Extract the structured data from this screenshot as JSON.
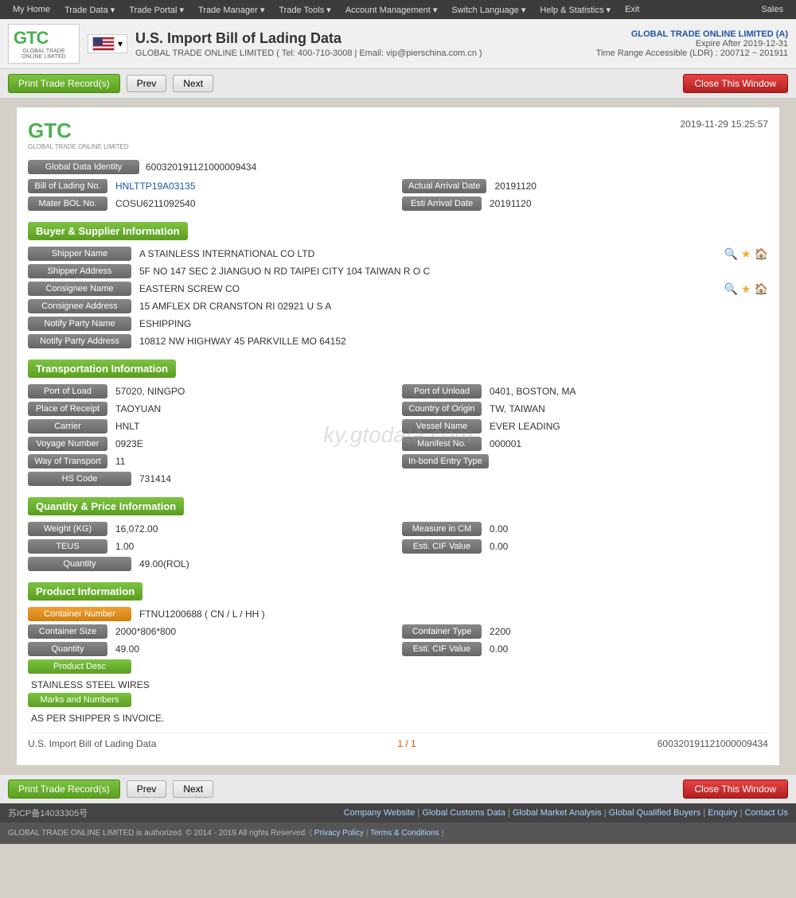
{
  "topnav": {
    "items": [
      "My Home",
      "Trade Data",
      "Trade Portal",
      "Trade Manager",
      "Trade Tools",
      "Account Management",
      "Switch Language",
      "Help & Statistics",
      "Exit"
    ],
    "right": "Sales"
  },
  "header": {
    "title": "U.S. Import Bill of Lading Data",
    "company_line": "GLOBAL TRADE ONLINE LIMITED ( Tel: 400-710-3008 | Email: vip@pierschina.com.cn )",
    "right_company": "GLOBAL TRADE ONLINE LIMITED (A)",
    "expire": "Expire After 2019-12-31",
    "ldr": "Time Range Accessible (LDR) : 200712 ~ 201911"
  },
  "toolbar": {
    "print_label": "Print Trade Record(s)",
    "prev_label": "Prev",
    "next_label": "Next",
    "close_label": "Close This Window"
  },
  "record": {
    "datetime": "2019-11-29 15:25:57",
    "global_data_identity_label": "Global Data Identity",
    "global_data_identity_value": "600320191121000009434",
    "bol_no_label": "Bill of Lading No.",
    "bol_no_value": "HNLTTP19A03135",
    "actual_arrival_label": "Actual Arrival Date",
    "actual_arrival_value": "20191120",
    "master_bol_label": "Mater BOL No.",
    "master_bol_value": "COSU6211092540",
    "esti_arrival_label": "Esti Arrival Date",
    "esti_arrival_value": "20191120",
    "sections": {
      "buyer_supplier": "Buyer & Supplier Information",
      "transportation": "Transportation Information",
      "quantity_price": "Quantity & Price Information",
      "product": "Product Information"
    },
    "shipper_name_label": "Shipper Name",
    "shipper_name_value": "A STAINLESS INTERNATIONAL CO LTD",
    "shipper_address_label": "Shipper Address",
    "shipper_address_value": "5F NO 147 SEC 2 JIANGUO N RD TAIPEI CITY 104 TAIWAN R O C",
    "consignee_name_label": "Consignee Name",
    "consignee_name_value": "EASTERN SCREW CO",
    "consignee_address_label": "Consignee Address",
    "consignee_address_value": "15 AMFLEX DR CRANSTON RI 02921 U S A",
    "notify_party_name_label": "Notify Party Name",
    "notify_party_name_value": "ESHIPPING",
    "notify_party_address_label": "Notify Party Address",
    "notify_party_address_value": "10812 NW HIGHWAY 45 PARKVILLE MO 64152",
    "port_of_load_label": "Port of Load",
    "port_of_load_value": "57020, NINGPO",
    "port_of_unload_label": "Port of Unload",
    "port_of_unload_value": "0401, BOSTON, MA",
    "place_of_receipt_label": "Place of Receipt",
    "place_of_receipt_value": "TAOYUAN",
    "country_of_origin_label": "Country of Origin",
    "country_of_origin_value": "TW, TAIWAN",
    "carrier_label": "Carrier",
    "carrier_value": "HNLT",
    "vessel_name_label": "Vessel Name",
    "vessel_name_value": "EVER LEADING",
    "voyage_number_label": "Voyage Number",
    "voyage_number_value": "0923E",
    "manifest_no_label": "Manifest No.",
    "manifest_no_value": "000001",
    "way_of_transport_label": "Way of Transport",
    "way_of_transport_value": "11",
    "inbond_entry_label": "In-bond Entry Type",
    "inbond_entry_value": "",
    "hs_code_label": "HS Code",
    "hs_code_value": "731414",
    "weight_kg_label": "Weight (KG)",
    "weight_kg_value": "16,072.00",
    "measure_cm_label": "Measure in CM",
    "measure_cm_value": "0.00",
    "teus_label": "TEUS",
    "teus_value": "1.00",
    "esti_cif_label": "Esti. CIF Value",
    "esti_cif_value": "0.00",
    "quantity_label": "Quantity",
    "quantity_value": "49.00(ROL)",
    "container_number_label": "Container Number",
    "container_number_value": "FTNU1200688 ( CN / L / HH )",
    "container_size_label": "Container Size",
    "container_size_value": "2000*806*800",
    "container_type_label": "Container Type",
    "container_type_value": "2200",
    "quantity2_label": "Quantity",
    "quantity2_value": "49.00",
    "esti_cif2_label": "Esti. CIF Value",
    "esti_cif2_value": "0.00",
    "product_desc_label": "Product Desc",
    "product_desc_value": "STAINLESS STEEL WIRES",
    "marks_numbers_label": "Marks and Numbers",
    "marks_numbers_value": "AS PER SHIPPER S INVOICE.",
    "bottom_label": "U.S. Import Bill of Lading Data",
    "pagination": "1 / 1",
    "bottom_id": "600320191121000009434"
  },
  "footer": {
    "icp": "苏ICP备14033305号",
    "links": [
      "Company Website",
      "Global Customs Data",
      "Global Market Analysis",
      "Global Qualified Buyers",
      "Enquiry",
      "Contact Us"
    ],
    "copyright": "GLOBAL TRADE ONLINE LIMITED is authorized. © 2014 - 2019 All rights Reserved.",
    "policy_links": [
      "Privacy Policy",
      "Terms & Conditions"
    ]
  },
  "watermark": "ky.gtodata.com"
}
